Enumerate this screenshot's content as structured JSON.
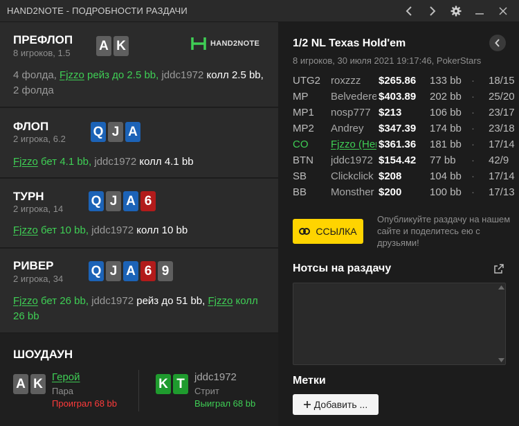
{
  "window": {
    "title": "HAND2NOTE - ПОДРОБНОСТИ РАЗДАЧИ"
  },
  "logo": {
    "text": "HAND2NOTE"
  },
  "preflop": {
    "label": "ПРЕФЛОП",
    "sub": "8 игроков, 1.5",
    "cards": [
      {
        "rank": "A",
        "suit": "grey"
      },
      {
        "rank": "K",
        "suit": "grey"
      }
    ],
    "a1": "4 фолда, ",
    "a2": "Fjzzo",
    "a3": " рейз до 2.5 bb, ",
    "a4": "jddc1972",
    "a5": " колл 2.5 bb, ",
    "a6": "2 фолда"
  },
  "flop": {
    "label": "ФЛОП",
    "sub": "2 игрока, 6.2",
    "cards": [
      {
        "rank": "Q",
        "suit": "blue"
      },
      {
        "rank": "J",
        "suit": "grey"
      },
      {
        "rank": "A",
        "suit": "blue"
      }
    ],
    "a1": "Fjzzo",
    "a2": " бет 4.1 bb, ",
    "a3": "jddc1972",
    "a4": " колл 4.1 bb"
  },
  "turn": {
    "label": "ТУРН",
    "sub": "2 игрока, 14",
    "cards": [
      {
        "rank": "Q",
        "suit": "blue"
      },
      {
        "rank": "J",
        "suit": "grey"
      },
      {
        "rank": "A",
        "suit": "blue"
      },
      {
        "rank": "6",
        "suit": "red"
      }
    ],
    "a1": "Fjzzo",
    "a2": " бет 10 bb, ",
    "a3": "jddc1972",
    "a4": " колл 10 bb"
  },
  "river": {
    "label": "РИВЕР",
    "sub": "2 игрока, 34",
    "cards": [
      {
        "rank": "Q",
        "suit": "blue"
      },
      {
        "rank": "J",
        "suit": "grey"
      },
      {
        "rank": "A",
        "suit": "blue"
      },
      {
        "rank": "6",
        "suit": "red"
      },
      {
        "rank": "9",
        "suit": "grey"
      }
    ],
    "a1": "Fjzzo",
    "a2": " бет 26 bb, ",
    "a3": "jddc1972",
    "a4": " рейз до 51 bb, ",
    "a5": "Fjzzo",
    "a6": " колл 26 bb"
  },
  "showdown": {
    "label": "ШОУДАУН",
    "hero": {
      "name": "Герой",
      "hand": "Пара",
      "result": "Проиграл 68 bb",
      "cards": [
        {
          "rank": "A",
          "suit": "grey"
        },
        {
          "rank": "K",
          "suit": "grey"
        }
      ]
    },
    "villain": {
      "name": "jddc1972",
      "hand": "Стрит",
      "result": "Выиграл 68 bb",
      "cards": [
        {
          "rank": "K",
          "suit": "green"
        },
        {
          "rank": "T",
          "suit": "green"
        }
      ]
    }
  },
  "info": {
    "title": "1/2 NL Texas Hold'em",
    "sub": "8 игроков, 30 июля 2021 19:17:46, PokerStars"
  },
  "players": [
    {
      "pos": "UTG2",
      "name": "roxzzz",
      "stack": "$265.86",
      "bb": "133 bb",
      "ratio": "18/15"
    },
    {
      "pos": "MP",
      "name": "Belvedere",
      "stack": "$403.89",
      "bb": "202 bb",
      "ratio": "25/20"
    },
    {
      "pos": "MP1",
      "name": "nosp777",
      "stack": "$213",
      "bb": "106 bb",
      "ratio": "23/17"
    },
    {
      "pos": "MP2",
      "name": "Andrey",
      "stack": "$347.39",
      "bb": "174 bb",
      "ratio": "23/18"
    },
    {
      "pos": "CO",
      "name": "Fjzzo (Hero)",
      "stack": "$361.36",
      "bb": "181 bb",
      "ratio": "17/14",
      "hero": true
    },
    {
      "pos": "BTN",
      "name": "jddc1972",
      "stack": "$154.42",
      "bb": "77 bb",
      "ratio": "42/9"
    },
    {
      "pos": "SB",
      "name": "Clickclick",
      "stack": "$208",
      "bb": "104 bb",
      "ratio": "17/14"
    },
    {
      "pos": "BB",
      "name": "Monsther",
      "stack": "$200",
      "bb": "100 bb",
      "ratio": "17/13"
    }
  ],
  "share": {
    "button": "ССЫЛКА",
    "text": "Опубликуйте раздачу на нашем сайте и поделитесь ею с друзьями!"
  },
  "notes": {
    "title": "Нотсы на раздачу",
    "value": ""
  },
  "tags": {
    "title": "Метки",
    "add": "Добавить ..."
  },
  "colors": {
    "hero": "#3fcf55",
    "accent": "#ffd400",
    "lost": "#ff3b3b",
    "won": "#3fcf55"
  }
}
